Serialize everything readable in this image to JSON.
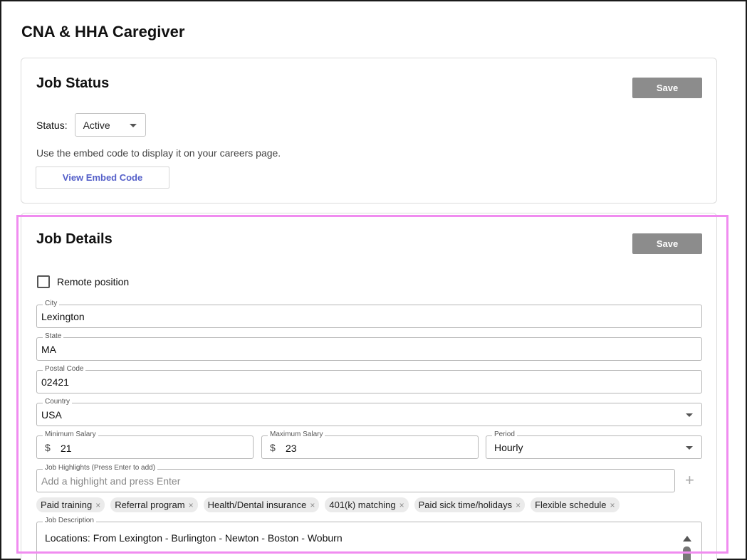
{
  "page": {
    "title": "CNA & HHA Caregiver"
  },
  "job_status": {
    "title": "Job Status",
    "save_label": "Save",
    "status_label": "Status:",
    "status_value": "Active",
    "embed_text": "Use the embed code to display it on your careers page.",
    "embed_button": "View Embed Code"
  },
  "job_details": {
    "title": "Job Details",
    "save_label": "Save",
    "remote_label": "Remote position",
    "city": {
      "label": "City",
      "value": "Lexington"
    },
    "state": {
      "label": "State",
      "value": "MA"
    },
    "postal": {
      "label": "Postal Code",
      "value": "02421"
    },
    "country": {
      "label": "Country",
      "value": "USA"
    },
    "min_salary": {
      "label": "Minimum Salary",
      "currency": "$",
      "value": "21"
    },
    "max_salary": {
      "label": "Maximum Salary",
      "currency": "$",
      "value": "23"
    },
    "period": {
      "label": "Period",
      "value": "Hourly"
    },
    "highlights": {
      "label": "Job Highlights (Press Enter to add)",
      "placeholder": "Add a highlight and press Enter",
      "plus": "+",
      "chips": [
        "Paid training",
        "Referral program",
        "Health/Dental insurance",
        "401(k) matching",
        "Paid sick time/holidays",
        "Flexible schedule"
      ],
      "remove_glyph": "×"
    },
    "description": {
      "label": "Job Description",
      "value": "Locations: From Lexington - Burlington - Newton - Boston - Woburn"
    }
  },
  "colors": {
    "save_button": "#8c8c8c",
    "link_blue": "#5560c9",
    "highlight_border": "#f08cf0"
  }
}
